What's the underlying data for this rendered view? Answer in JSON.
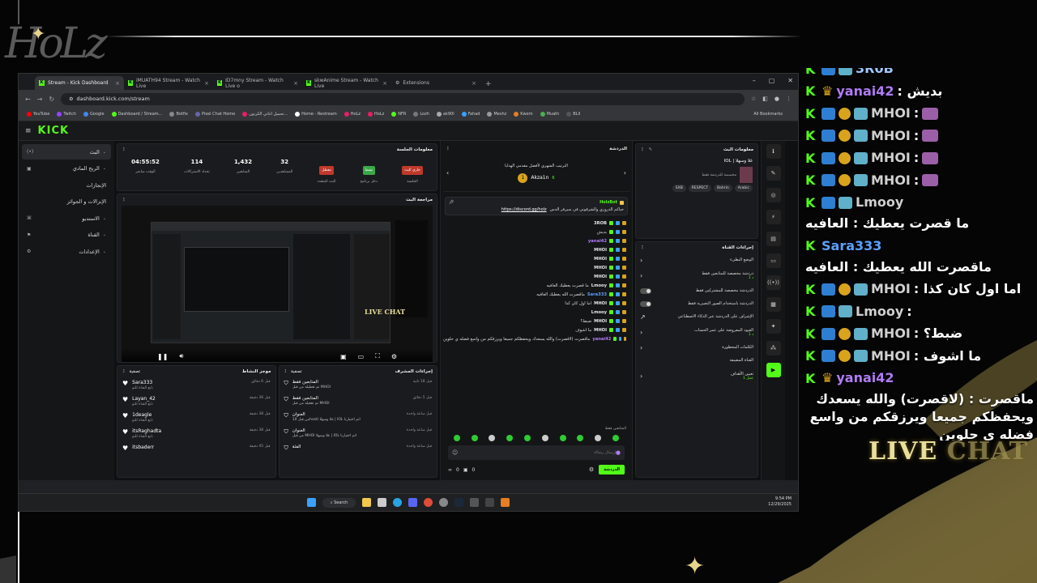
{
  "browser": {
    "tabs": [
      {
        "label": "Stream - Kick Dashboard",
        "active": true
      },
      {
        "label": "iMUATH94 Stream - Watch Live",
        "active": false
      },
      {
        "label": "ID7mny Stream - Watch Live o",
        "active": false
      },
      {
        "label": "skwAnime Stream - Watch Live",
        "active": false
      },
      {
        "label": "Extensions",
        "active": false
      }
    ],
    "url": "dashboard.kick.com/stream",
    "bookmarks": [
      "YouTube",
      "Twitch",
      "Google",
      "Dashboard / Stream...",
      "Botfix",
      "Pixel Chat Home",
      "تحميل اغاني الكرتون...",
      "Home - Restream",
      "HoLz",
      "HoLz",
      "NFR",
      "Lozh",
      "ak90l",
      "Fahad",
      "Meshz",
      "Kwem",
      "Muath",
      "BLll"
    ],
    "all_bookmarks": "All Bookmarks"
  },
  "kick": {
    "logo": "KICK"
  },
  "sidebar": {
    "items": [
      {
        "label": "البث",
        "icon": "(•)"
      },
      {
        "label": "الربح المادي",
        "icon": "▣"
      },
      {
        "label": "الإنجازات",
        "icon": ""
      },
      {
        "label": "الإنزالات و الجوائز",
        "icon": ""
      },
      {
        "label": "الاستديو",
        "icon": "⌘"
      },
      {
        "label": "القناة",
        "icon": "⚑"
      },
      {
        "label": "الإعدادات",
        "icon": "⚙"
      }
    ]
  },
  "session": {
    "title": "معلومات الجلسة",
    "stats": [
      {
        "value": "04:55:52",
        "label": "الوقت مباشر"
      },
      {
        "value": "114",
        "label": "تحداد الاشتراكات"
      },
      {
        "value": "1,432",
        "label": "المتابعين"
      },
      {
        "value": "32",
        "label": "المشاهدين"
      },
      {
        "value": "معطل",
        "label": "البث المتعدد",
        "pill": "#c0392b"
      },
      {
        "value": "نشط",
        "label": "دخل برنامج",
        "pill": "#3aa84a"
      },
      {
        "value": "جاري البث",
        "label": "الجلسة",
        "pill": "#c0392b"
      }
    ]
  },
  "preview": {
    "title": "مراجعة البث"
  },
  "activity": {
    "title": "موجز النشاط",
    "filter": "تصفية",
    "items": [
      {
        "name": "Sara333",
        "sub": "تابع القناة للتو",
        "time": "قبل 6 دقائق"
      },
      {
        "name": "Layan_42",
        "sub": "تابع القناة للتو",
        "time": "قبل 36 دقيقة"
      },
      {
        "name": "1deagle",
        "sub": "تابع القناة للتو",
        "time": "قبل 38 دقيقة"
      },
      {
        "name": "itsRaghadta",
        "sub": "تابع القناة للتو",
        "time": "قبل 38 دقيقة"
      },
      {
        "name": "itsbaderr",
        "sub": "",
        "time": "قبل 45 دقيقة"
      }
    ]
  },
  "modactions": {
    "title": "إجراءات المشرف",
    "filter": "تصفية",
    "items": [
      {
        "title": "المتابعين فقط",
        "sub": "تم تعطيله من قبل MHOI",
        "time": "قبل 18 ثانية"
      },
      {
        "title": "المتابعين فقط",
        "sub": "تم تفعيله من قبل MHOI",
        "time": "قبل 5 دقائق"
      },
      {
        "title": "العنوان",
        "sub": "من قبل 10hosti غلا وسهلا | IOL اتم اختيارنا",
        "time": "قبل ساعة واحدة"
      },
      {
        "title": "العنوان",
        "sub": "من قبل MHOI غلا وسهلا | IOL اتم اختيارنا",
        "time": "قبل ساعة واحدة"
      },
      {
        "title": "الفئة",
        "sub": "",
        "time": "قبل ساعة واحدة"
      }
    ]
  },
  "chat": {
    "title": "الدردشة",
    "leaderboard_title": "الترتيب الشهري لأفضل مقدمي الهدايا",
    "top_user": "Akza1n",
    "top_count": "6",
    "pinned_user": "HolzBot",
    "pinned_text": "حياكم الدروزي والشرقوني في سيرفر الدس",
    "pinned_link": "https://discord.gg/holz",
    "lines": [
      {
        "user": "3ROB",
        "text": ""
      },
      {
        "user": "",
        "text": "بديش"
      },
      {
        "user": "yanai42",
        "text": ""
      },
      {
        "user": "MHOI",
        "text": ""
      },
      {
        "user": "MHOI",
        "text": ""
      },
      {
        "user": "MHOI",
        "text": ""
      },
      {
        "user": "MHOI",
        "text": ""
      },
      {
        "user": "Lmooy",
        "text": "ما قصرت يعطيك العافيه"
      },
      {
        "user": "Sara333",
        "text": "ماقصرت الله يعطيك العافيه"
      },
      {
        "user": "MHOI",
        "text": "اما اول كان كذا"
      },
      {
        "user": "Lmooy",
        "text": ""
      },
      {
        "user": "MHOI",
        "text": "ضبط؟"
      },
      {
        "user": "MHOI",
        "text": "ما اشوف"
      },
      {
        "user": "yanai42",
        "text": "ماقصرت (لاقصرت) والله يسعدك ويحفظكم جميعا ويرزقكم من واسع فضله ي حلوين"
      }
    ],
    "followers_only": "المتابعين فقط",
    "send_placeholder": "إرسال رسالة",
    "send_button": "الدردشة",
    "count_left": "0",
    "count_right": "0"
  },
  "streaminfo": {
    "title": "معلومات البث",
    "stream_title": "IOL | غلا وسهلا",
    "category": "مخصصة للدردشة فقط",
    "tags": [
      "Arabic",
      "Bahrin",
      "RESPECT",
      "SXB"
    ]
  },
  "channelactions": {
    "title": "إجراءات القناة",
    "rows": [
      {
        "label": "الوضع البطيء",
        "ctrl": "›"
      },
      {
        "label": "دردشة مخصصة للمتابعين فقط",
        "ctrl": "›",
        "sub": "1 د"
      },
      {
        "label": "الدردشة مخصصة للمشتركين فقط",
        "ctrl": "toggle"
      },
      {
        "label": "الدردشة باستخدام الصور التعبيرية فقط",
        "ctrl": "toggle"
      },
      {
        "label": "الإشراف على الدردشة عبر الذكاء الاصطناعي",
        "ctrl": "↗"
      },
      {
        "label": "القيود المفروضة على عمر الحساب",
        "ctrl": "›",
        "sub": "1 د"
      },
      {
        "label": "الكلمات المحظورة",
        "ctrl": "›"
      },
      {
        "label": "القناة المضيفة",
        "ctrl": ""
      },
      {
        "label": "تعيين الأهداف",
        "ctrl": "›",
        "sub": "1 عمل"
      }
    ]
  },
  "taskbar": {
    "search": "Search",
    "time": "9:54 PM",
    "date": "12/29/2025"
  },
  "overlay": {
    "lines": [
      {
        "user": "3R0B",
        "text": "",
        "color": "#a0c8ff",
        "cut": true
      },
      {
        "user": "yanai42",
        "text": "بديش :",
        "color": "#b07cf5"
      },
      {
        "user": "MHOI",
        "text": ":",
        "color": "#d0d0d0"
      },
      {
        "user": "MHOI",
        "text": ":",
        "color": "#d0d0d0"
      },
      {
        "user": "MHOI",
        "text": ":",
        "color": "#d0d0d0"
      },
      {
        "user": "MHOI",
        "text": ":",
        "color": "#d0d0d0"
      },
      {
        "user": "Lmooy",
        "text": "ما قصرت يعطيك : العافيه",
        "color": "#d0d0d0"
      },
      {
        "user": "Sara333",
        "text": "ماقصرت الله يعطيك : العافيه",
        "color": "#5aa0ff"
      },
      {
        "user": "MHOI",
        "text": "اما اول كان كذا :",
        "color": "#d0d0d0"
      },
      {
        "user": "Lmooy",
        "text": ":",
        "color": "#d0d0d0"
      },
      {
        "user": "MHOI",
        "text": "ضبط؟ :",
        "color": "#d0d0d0"
      },
      {
        "user": "MHOI",
        "text": "ما اشوف :",
        "color": "#d0d0d0"
      },
      {
        "user": "yanai42",
        "text": "ماقصرت : (لاقصرت) والله يسعدك ويحفظكم جميعا ويرزقكم من واسع فضله ي حلوين",
        "color": "#b07cf5"
      }
    ],
    "live_label_a": "LIVE",
    "live_label_b": "CHAT"
  },
  "colors": {
    "kick_green": "#53fc18",
    "accent_gold": "#e7d48b"
  }
}
